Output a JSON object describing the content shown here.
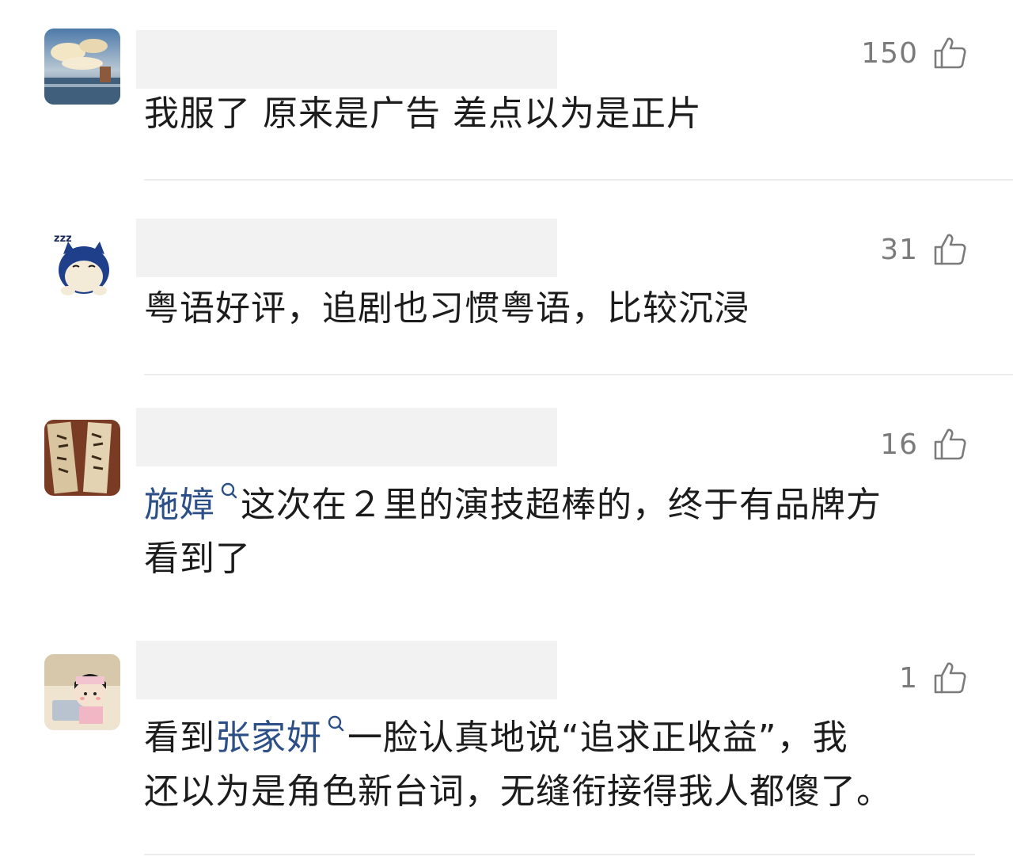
{
  "comments": [
    {
      "likes": "150",
      "text": "我服了 原来是广告 差点以为是正片"
    },
    {
      "likes": "31",
      "text": "粤语好评，追剧也习惯粤语，比较沉浸"
    },
    {
      "likes": "16",
      "mention": "施嫜",
      "text_after": "这次在２里的演技超棒的，终于有品牌方",
      "text_line2": "看到了"
    },
    {
      "likes": "1",
      "text_before": "看到",
      "mention": "张家妍",
      "text_after": "一脸认真地说“追求正收益”，我",
      "text_line2": "还以为是角色新台词，无缝衔接得我人都傻了。"
    }
  ],
  "colors": {
    "mention": "#2b4f86",
    "like_count": "#7b7b7b",
    "divider": "#ececec",
    "name_placeholder": "#f2f2f2"
  },
  "icons": {
    "like": "thumbs-up-icon",
    "mention": "search-magnifier-icon"
  }
}
